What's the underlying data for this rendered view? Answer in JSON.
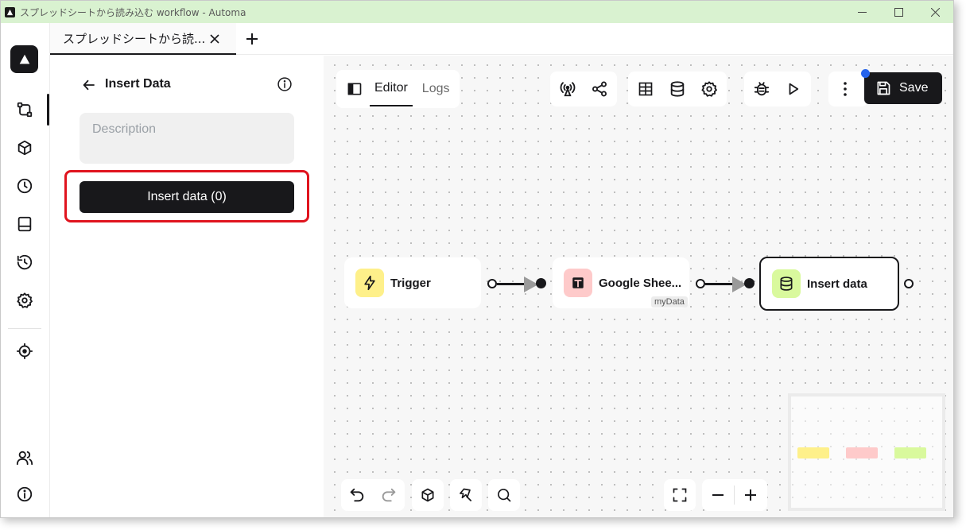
{
  "window": {
    "title": "スプレッドシートから読み込む workflow - Automa"
  },
  "tabs": [
    {
      "label": "スプレッドシートから読..."
    }
  ],
  "panel": {
    "title": "Insert Data",
    "description_placeholder": "Description",
    "insert_button_label": "Insert data (0)"
  },
  "toolbar": {
    "tabs": [
      {
        "label": "Editor",
        "active": true
      },
      {
        "label": "Logs",
        "active": false
      }
    ],
    "save_label": "Save"
  },
  "nodes": [
    {
      "label": "Trigger",
      "icon": "lightning-icon",
      "color": "#fef08a"
    },
    {
      "label": "Google Shee...",
      "icon": "sheets-icon",
      "color": "#fecaca",
      "tag": "myData"
    },
    {
      "label": "Insert data",
      "icon": "database-icon",
      "color": "#d9f99d"
    }
  ],
  "minimap": {
    "colors": [
      "#fef08a",
      "#fecaca",
      "#d9f99d"
    ]
  },
  "colors": {
    "accent": "#18181b",
    "highlight": "#e0141e",
    "notification_dot": "#2563eb",
    "titlebar": "#d9f2d0"
  }
}
